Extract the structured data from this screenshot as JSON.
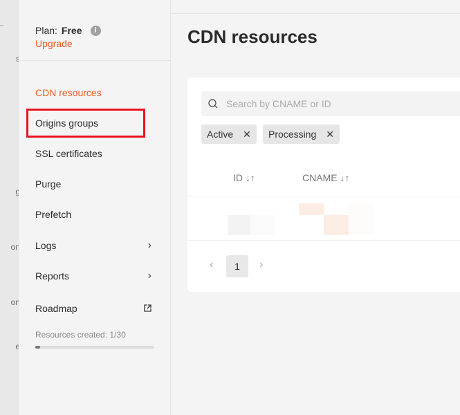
{
  "left_rail": {
    "fragments": [
      "s",
      "g",
      "on",
      "on",
      "e"
    ]
  },
  "plan": {
    "label": "Plan:",
    "value": "Free",
    "upgrade": "Upgrade"
  },
  "nav": [
    {
      "label": "CDN resources",
      "active": true
    },
    {
      "label": "Origins groups"
    },
    {
      "label": "SSL certificates"
    },
    {
      "label": "Purge"
    },
    {
      "label": "Prefetch"
    },
    {
      "label": "Logs"
    },
    {
      "label": "Reports"
    },
    {
      "label": "Roadmap"
    }
  ],
  "resources": {
    "text": "Resources created: 1/30",
    "fraction": 0.033
  },
  "page_title": "CDN resources",
  "search": {
    "placeholder": "Search by CNAME or ID"
  },
  "filters": [
    "Active",
    "Processing"
  ],
  "columns": [
    "ID ↓↑",
    "CNAME ↓↑"
  ],
  "pagination": {
    "current": "1"
  },
  "colors": {
    "accent": "#f05a22",
    "highlight": "#e8141e"
  }
}
